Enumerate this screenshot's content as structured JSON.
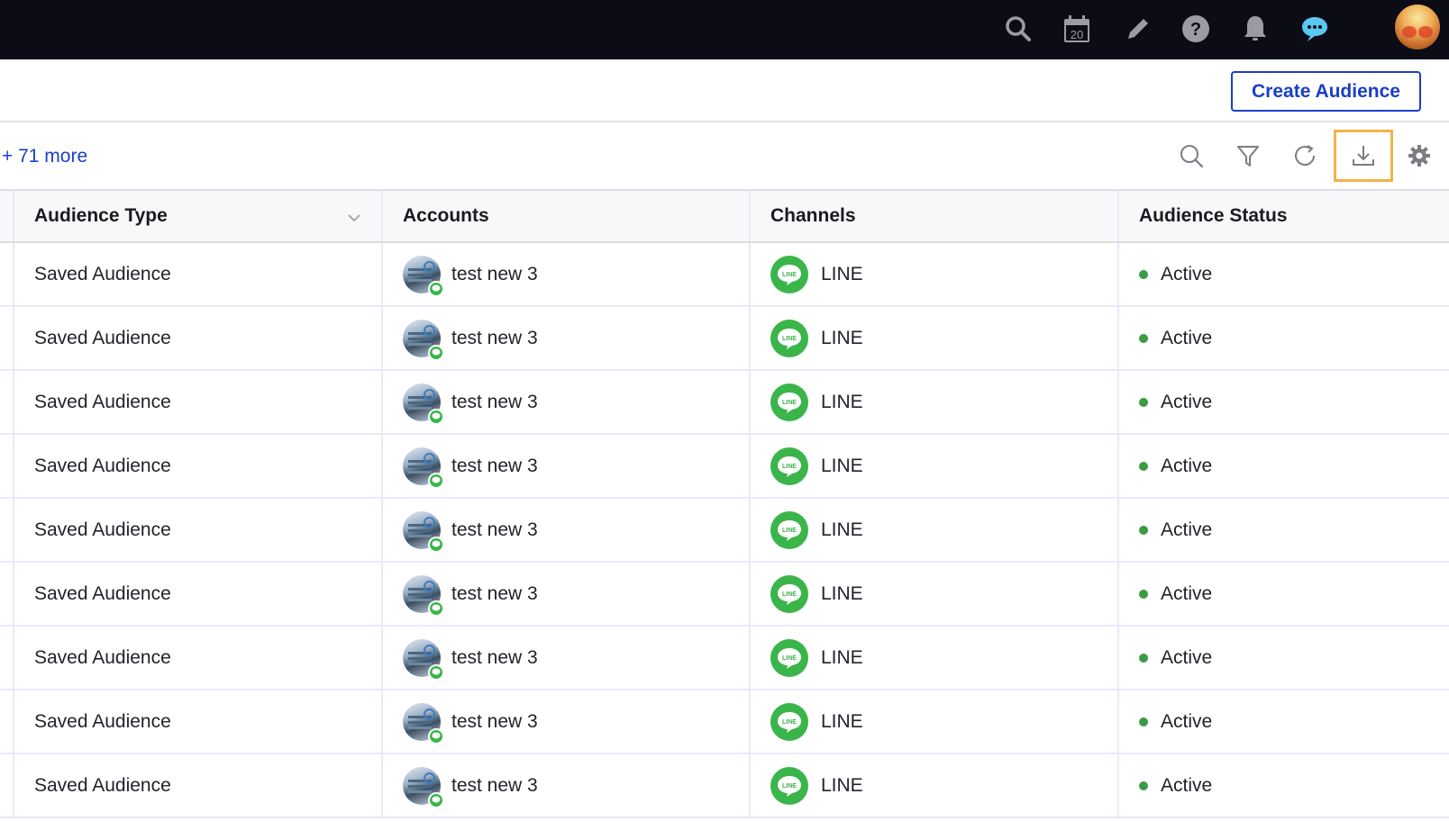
{
  "topbar": {
    "icons": [
      "search-icon",
      "calendar-icon",
      "pencil-icon",
      "help-icon",
      "bell-icon",
      "chat-icon"
    ],
    "calendar_day": "20",
    "chat_color": "#5bc8f0",
    "icon_color": "#9b9ba3"
  },
  "header": {
    "create_button_label": "Create Audience"
  },
  "toolbar": {
    "more_link": "+ 71 more",
    "tools": [
      "search-icon",
      "filter-icon",
      "refresh-icon",
      "download-icon",
      "settings-icon"
    ],
    "highlighted_tool": "download-icon"
  },
  "table": {
    "columns": [
      {
        "label": "Audience Type",
        "sortable": true
      },
      {
        "label": "Accounts"
      },
      {
        "label": "Channels"
      },
      {
        "label": "Audience Status"
      }
    ],
    "rows": [
      {
        "type": "Saved Audience",
        "account": "test new 3",
        "channel": "LINE",
        "status": "Active"
      },
      {
        "type": "Saved Audience",
        "account": "test new 3",
        "channel": "LINE",
        "status": "Active"
      },
      {
        "type": "Saved Audience",
        "account": "test new 3",
        "channel": "LINE",
        "status": "Active"
      },
      {
        "type": "Saved Audience",
        "account": "test new 3",
        "channel": "LINE",
        "status": "Active"
      },
      {
        "type": "Saved Audience",
        "account": "test new 3",
        "channel": "LINE",
        "status": "Active"
      },
      {
        "type": "Saved Audience",
        "account": "test new 3",
        "channel": "LINE",
        "status": "Active"
      },
      {
        "type": "Saved Audience",
        "account": "test new 3",
        "channel": "LINE",
        "status": "Active"
      },
      {
        "type": "Saved Audience",
        "account": "test new 3",
        "channel": "LINE",
        "status": "Active"
      },
      {
        "type": "Saved Audience",
        "account": "test new 3",
        "channel": "LINE",
        "status": "Active"
      }
    ],
    "line_logo_text": "LINE",
    "status_color": "#3b9a46",
    "line_color": "#3ab54a"
  }
}
